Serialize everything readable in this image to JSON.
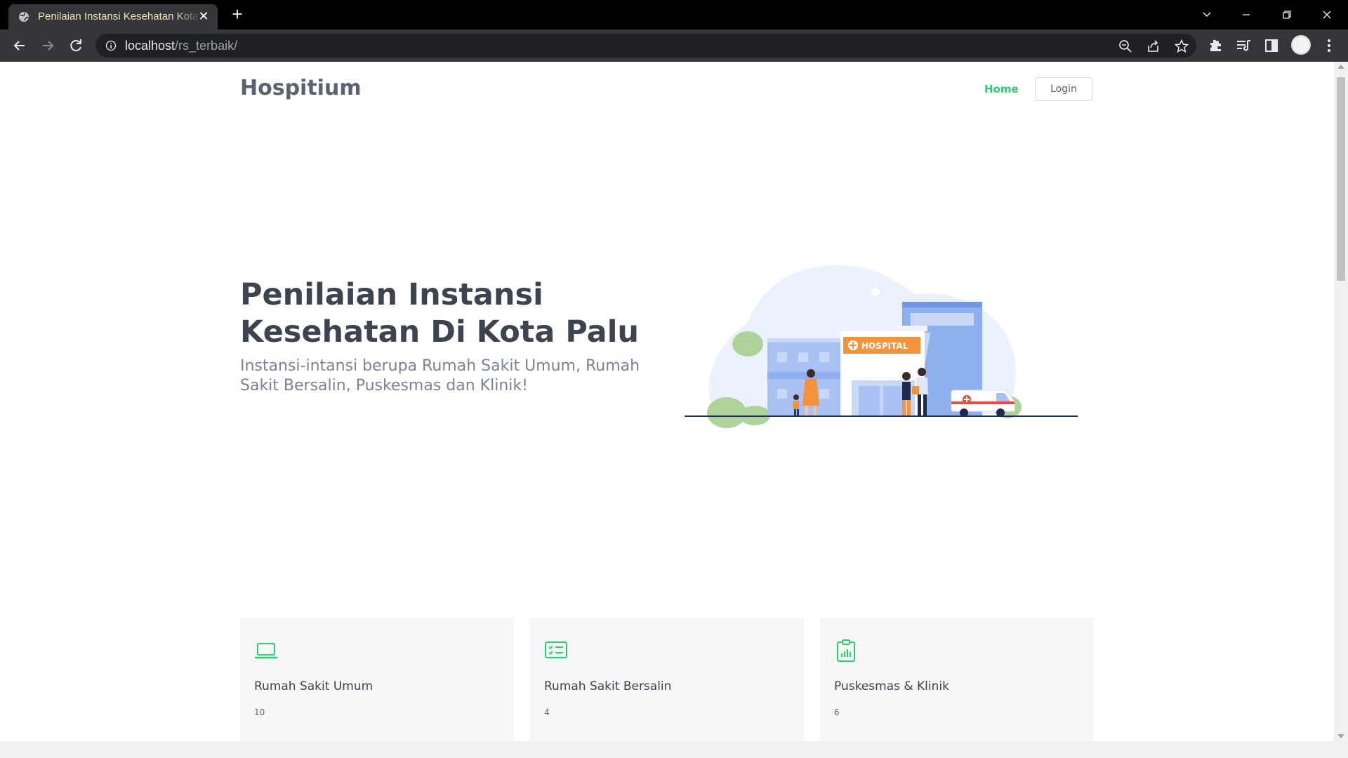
{
  "browser": {
    "tab_title": "Penilaian Instansi Kesehatan Kota Palu",
    "url_host": "localhost",
    "url_path": "/rs_terbaik/"
  },
  "site": {
    "brand": "Hospitium",
    "nav": {
      "home": "Home",
      "login": "Login"
    },
    "accent_color": "#2ecc71"
  },
  "hero": {
    "title_line1": "Penilaian Instansi",
    "title_line2": "Kesehatan Di Kota Palu",
    "subtitle": "Instansi-intansi berupa Rumah Sakit Umum, Rumah Sakit Bersalin, Puskesmas dan Klinik!",
    "illustration_sign": "HOSPITAL"
  },
  "cards": [
    {
      "icon": "laptop-icon",
      "label": "Rumah Sakit Umum",
      "count": "10"
    },
    {
      "icon": "checklist-icon",
      "label": "Rumah Sakit Bersalin",
      "count": "4"
    },
    {
      "icon": "clipboard-chart-icon",
      "label": "Puskesmas & Klinik",
      "count": "6"
    }
  ]
}
